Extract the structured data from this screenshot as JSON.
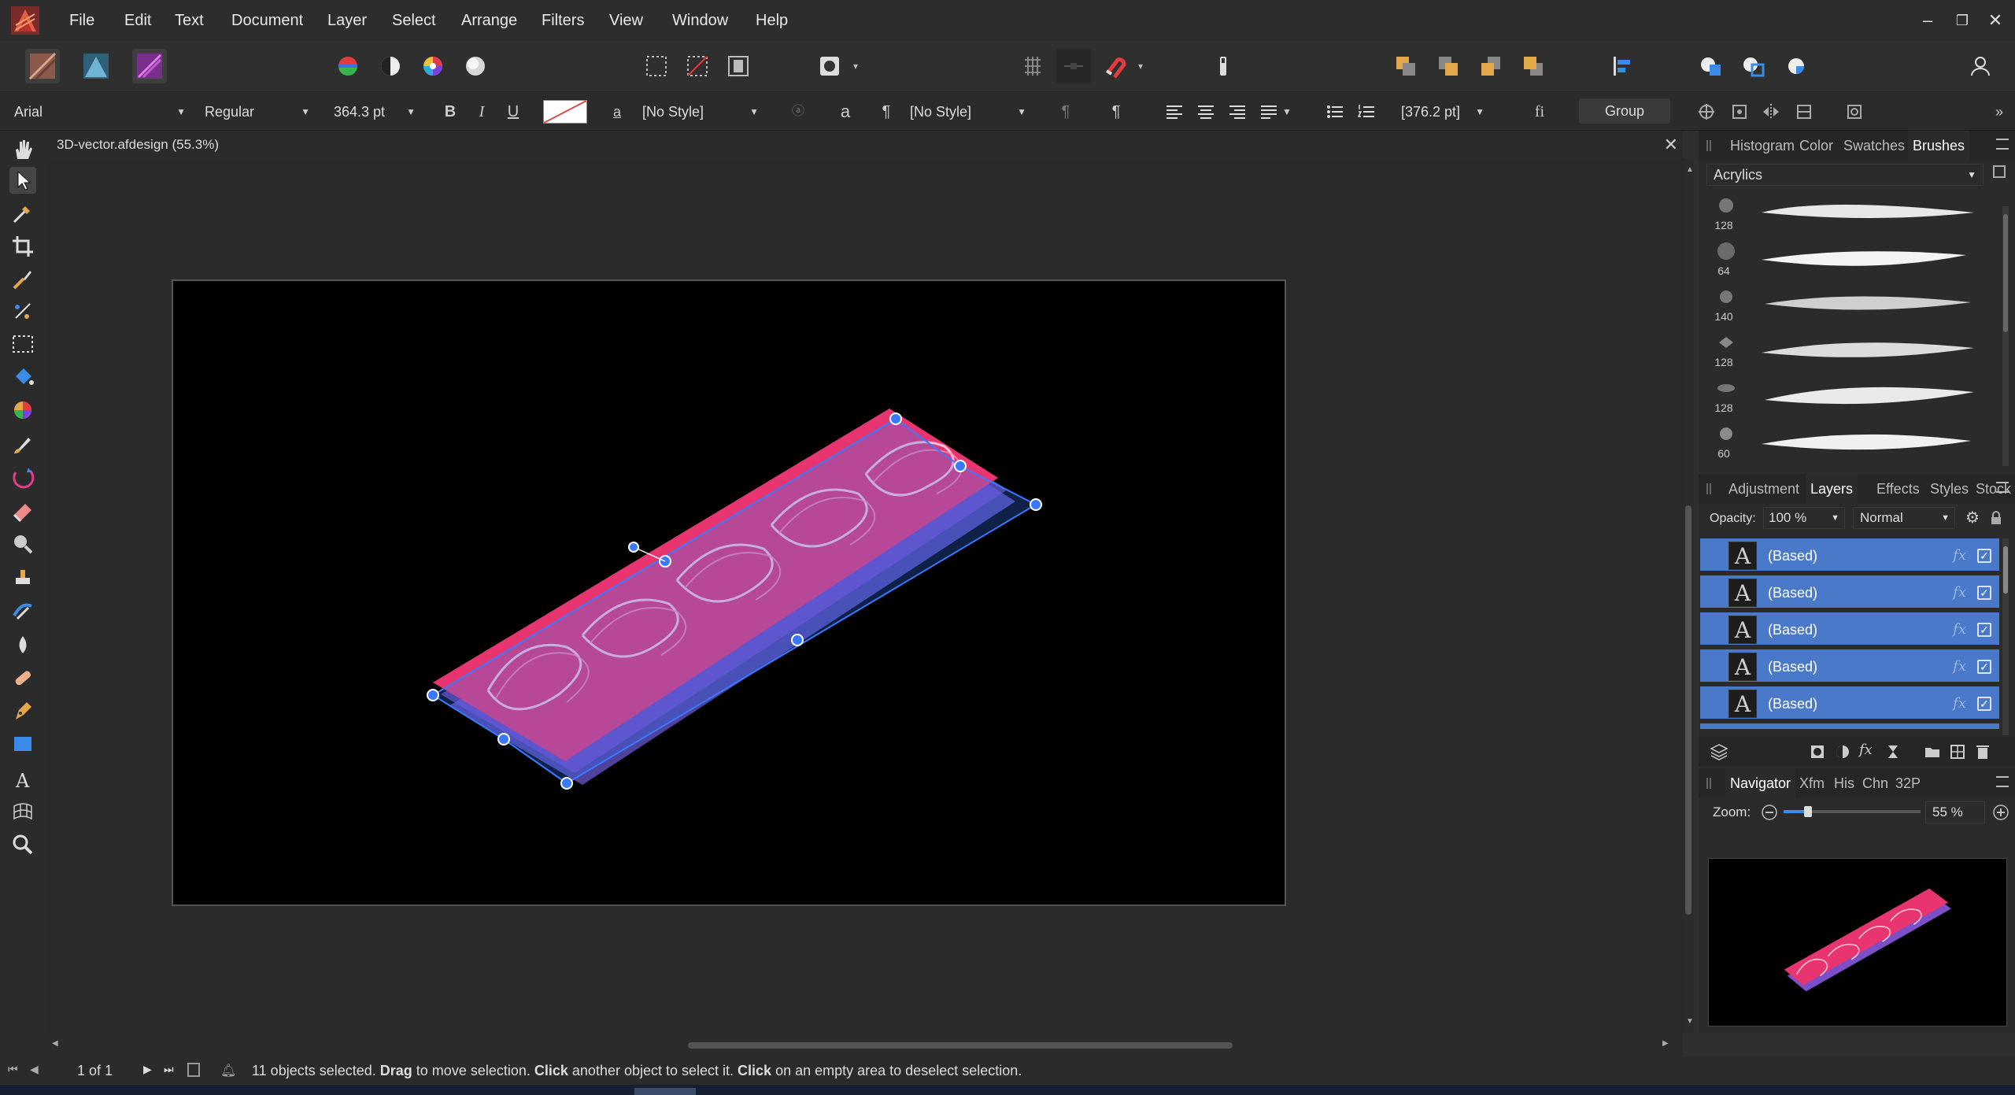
{
  "menu": {
    "items": [
      "File",
      "Edit",
      "Text",
      "Document",
      "Layer",
      "Select",
      "Arrange",
      "Filters",
      "View",
      "Window",
      "Help"
    ]
  },
  "context": {
    "font_family": "Arial",
    "font_style": "Regular",
    "font_size": "364.3 pt",
    "bold": "B",
    "italic": "I",
    "underline": "U",
    "char_style": "[No Style]",
    "para_style": "[No Style]",
    "leading": "[376.2 pt]",
    "ligature": "fi",
    "group_label": "Group"
  },
  "document": {
    "tab_title": "3D-vector.afdesign (55.3%)"
  },
  "panels": {
    "top_tabs": [
      "Histogram",
      "Color",
      "Swatches",
      "Brushes"
    ],
    "top_active": "Brushes",
    "brush_category": "Acrylics",
    "brush_sizes": [
      "128",
      "64",
      "140",
      "128",
      "128",
      "60"
    ],
    "mid_tabs": [
      "Adjustment",
      "Layers",
      "Effects",
      "Styles",
      "Stock"
    ],
    "mid_active": "Layers",
    "opacity_label": "Opacity:",
    "opacity_value": "100 %",
    "blend_mode": "Normal",
    "layers": [
      "(Based)",
      "(Based)",
      "(Based)",
      "(Based)",
      "(Based)"
    ],
    "bottom_tabs": [
      "Navigator",
      "Xfm",
      "His",
      "Chn",
      "32P"
    ],
    "bottom_active": "Navigator",
    "zoom_label": "Zoom:",
    "zoom_value": "55 %",
    "zoom_level": 0.55
  },
  "status": {
    "page": "1 of 1",
    "message_count": "11 objects selected.",
    "drag_word": "Drag",
    "drag_text": " to move selection. ",
    "click_word": "Click",
    "click_text": " another object to select it. ",
    "click_word2": "Click",
    "click_text2": " on an empty area to deselect selection."
  },
  "colors": {
    "selection": "#4a79c9",
    "accent_pink": "#e8356f",
    "bbox_blue": "#3a78ff"
  }
}
